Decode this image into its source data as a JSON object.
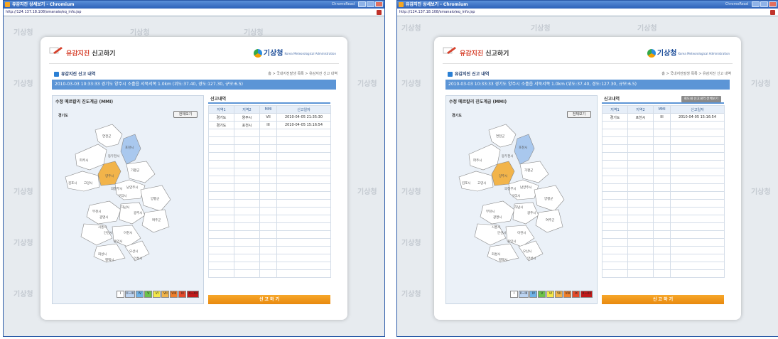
{
  "windows": [
    {
      "title": "유감지진 상세보기 - Chromium",
      "brand": "ChromeRead",
      "url": "http://124.137.18.108/smanaio/eq_info.jsp",
      "watermark": "기상청",
      "dialog": {
        "title_highlight": "유감지진",
        "title_rest": " 신고하기",
        "logo_text": "기상청",
        "logo_sub": "Korea Meteorological Administration",
        "section_title": "유감지진 신고 내역",
        "breadcrumb": "홈 > 국내지진발생 목록 > 유감지진 신고 내역",
        "event_bar": "2010-03-03 10:33:33  경기도 양주시 소흘읍 서북서쪽 1.0km  (위도:37.40, 경도:127.30, 규모:6.5)",
        "map_title": "수정 메르칼리 진도계급 (MMI)",
        "whole_view_label": "전체보기",
        "region_label": "경기도",
        "legend": [
          "I",
          "II~III",
          "IV",
          "V",
          "VI",
          "VII",
          "VIII",
          "IX",
          "X~XII"
        ],
        "report_title": "신고내역",
        "report_all_button": "",
        "table_headers": [
          "지역1",
          "지역2",
          "MMI",
          "신고일자"
        ],
        "rows": [
          [
            "경기도",
            "양주시",
            "VII",
            "2010-04-05 21:35:30"
          ],
          [
            "경기도",
            "포천시",
            "III",
            "2010-04-05 15:16:54"
          ]
        ],
        "submit_label": "신 고 하 기"
      }
    },
    {
      "title": "유감지진 상세보기 - Chromium",
      "brand": "ChromeRead",
      "url": "http://124.137.18.108/smanaio/eq_info.jsp",
      "watermark": "기상청",
      "dialog": {
        "title_highlight": "유감지진",
        "title_rest": " 신고하기",
        "logo_text": "기상청",
        "logo_sub": "Korea Meteorological Administration",
        "section_title": "유감지진 신고 내역",
        "breadcrumb": "홈 > 국내지진발생 목록 > 유감지진 신고 내역",
        "event_bar": "2010-03-03 10:33:33  경기도 양주시 소흘읍 서북서쪽 1.0km  (위도:37.40, 경도:127.30, 규모:6.5)",
        "map_title": "수정 메르칼리 진도계급 (MMI)",
        "whole_view_label": "전체보기",
        "region_label": "경기도",
        "legend": [
          "I",
          "II~III",
          "IV",
          "V",
          "VI",
          "VII",
          "VIII",
          "IX",
          "X~XII"
        ],
        "report_title": "신고내역",
        "report_all_button": "회도내 신고내역 전체보기",
        "table_headers": [
          "지역1",
          "지역2",
          "MMI",
          "신고일자"
        ],
        "rows": [
          [
            "경기도",
            "포천시",
            "III",
            "2010-04-05 15:16:54"
          ]
        ],
        "submit_label": "신 고 하 기"
      }
    }
  ],
  "map_labels": [
    "연천군",
    "포천시",
    "동두천시",
    "파주시",
    "양주시",
    "가평군",
    "김포시",
    "고양시",
    "의정부시",
    "남양주시",
    "구리시",
    "하남시",
    "양평군",
    "부천시",
    "광명시",
    "시흥시",
    "안산시",
    "광주시",
    "여주군",
    "이천시",
    "용인시",
    "오산시",
    "화성시",
    "평택시",
    "안성시"
  ],
  "colors": {
    "accent": "#5c95d6",
    "highlight_vii": "#f2b44a",
    "highlight_iii": "#a9c8ee",
    "submit": "#f09a1e",
    "legend": [
      "#ffffff",
      "#bcd4f2",
      "#6fb3e8",
      "#6cc24a",
      "#f4e84a",
      "#f2b44a",
      "#f07f2a",
      "#e44a2a",
      "#c01a1a"
    ]
  }
}
